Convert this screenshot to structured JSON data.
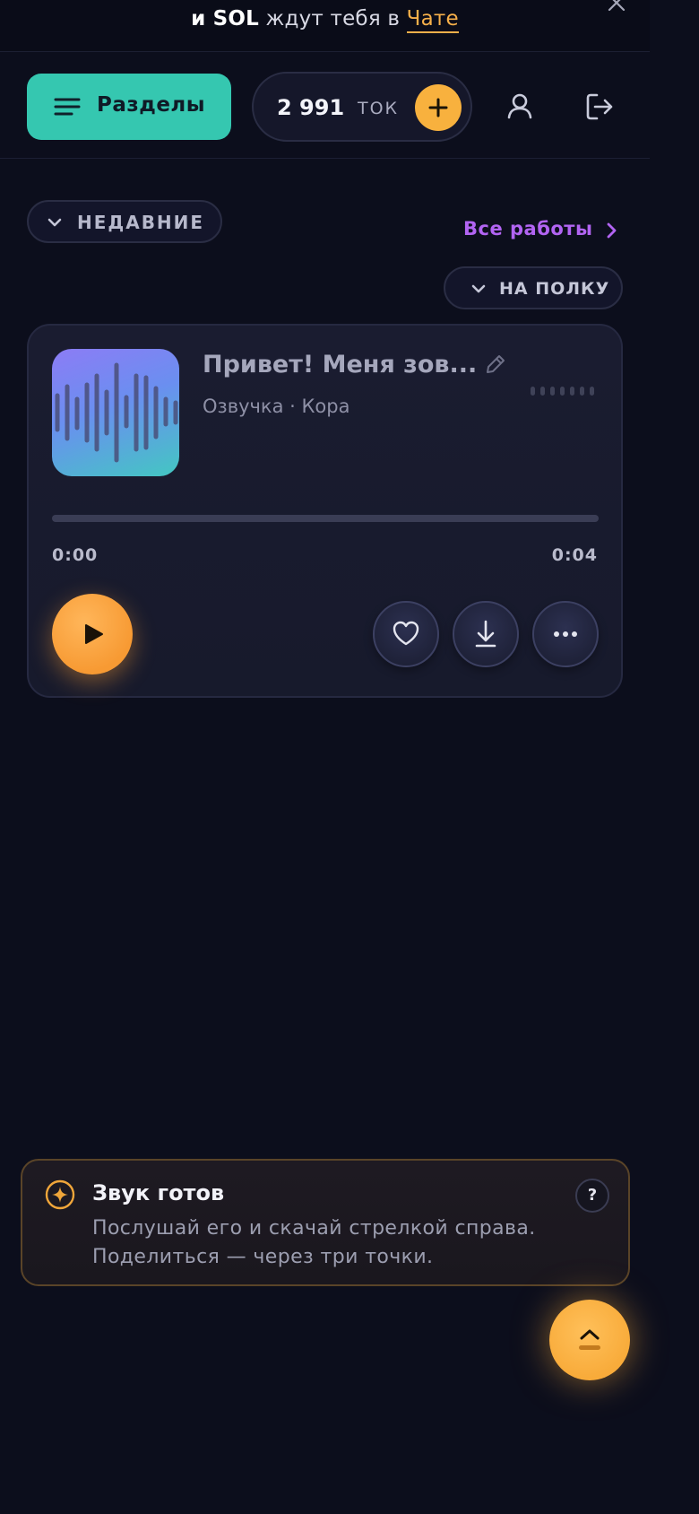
{
  "banner": {
    "text_bold": "и SOL",
    "text_mid": " ждут тебя в ",
    "link": "Чате",
    "close_icon": "close-icon"
  },
  "header": {
    "menu_label": "Разделы",
    "tokens_value": "2 991",
    "tokens_unit": "ТОК",
    "add_icon": "plus-icon",
    "profile_icon": "user-icon",
    "logout_icon": "logout-icon"
  },
  "filters": {
    "recent_label": "НЕДАВНИЕ",
    "all_works_label": "Все работы",
    "shelf_label": "НА ПОЛКУ"
  },
  "track": {
    "title": "Привет! Меня зов...",
    "subtitle": "Озвучка · Кора",
    "time_current": "0:00",
    "time_total": "0:04",
    "progress": 0
  },
  "hint": {
    "title": "Звук готов",
    "text": "Послушай его и скачай стрелкой справа. Поделиться — через три точки.",
    "help": "?"
  },
  "colors": {
    "accent_teal": "#35c7b0",
    "accent_orange": "#f8b13e",
    "accent_purple": "#b264f2",
    "background": "#0c0e1c"
  }
}
